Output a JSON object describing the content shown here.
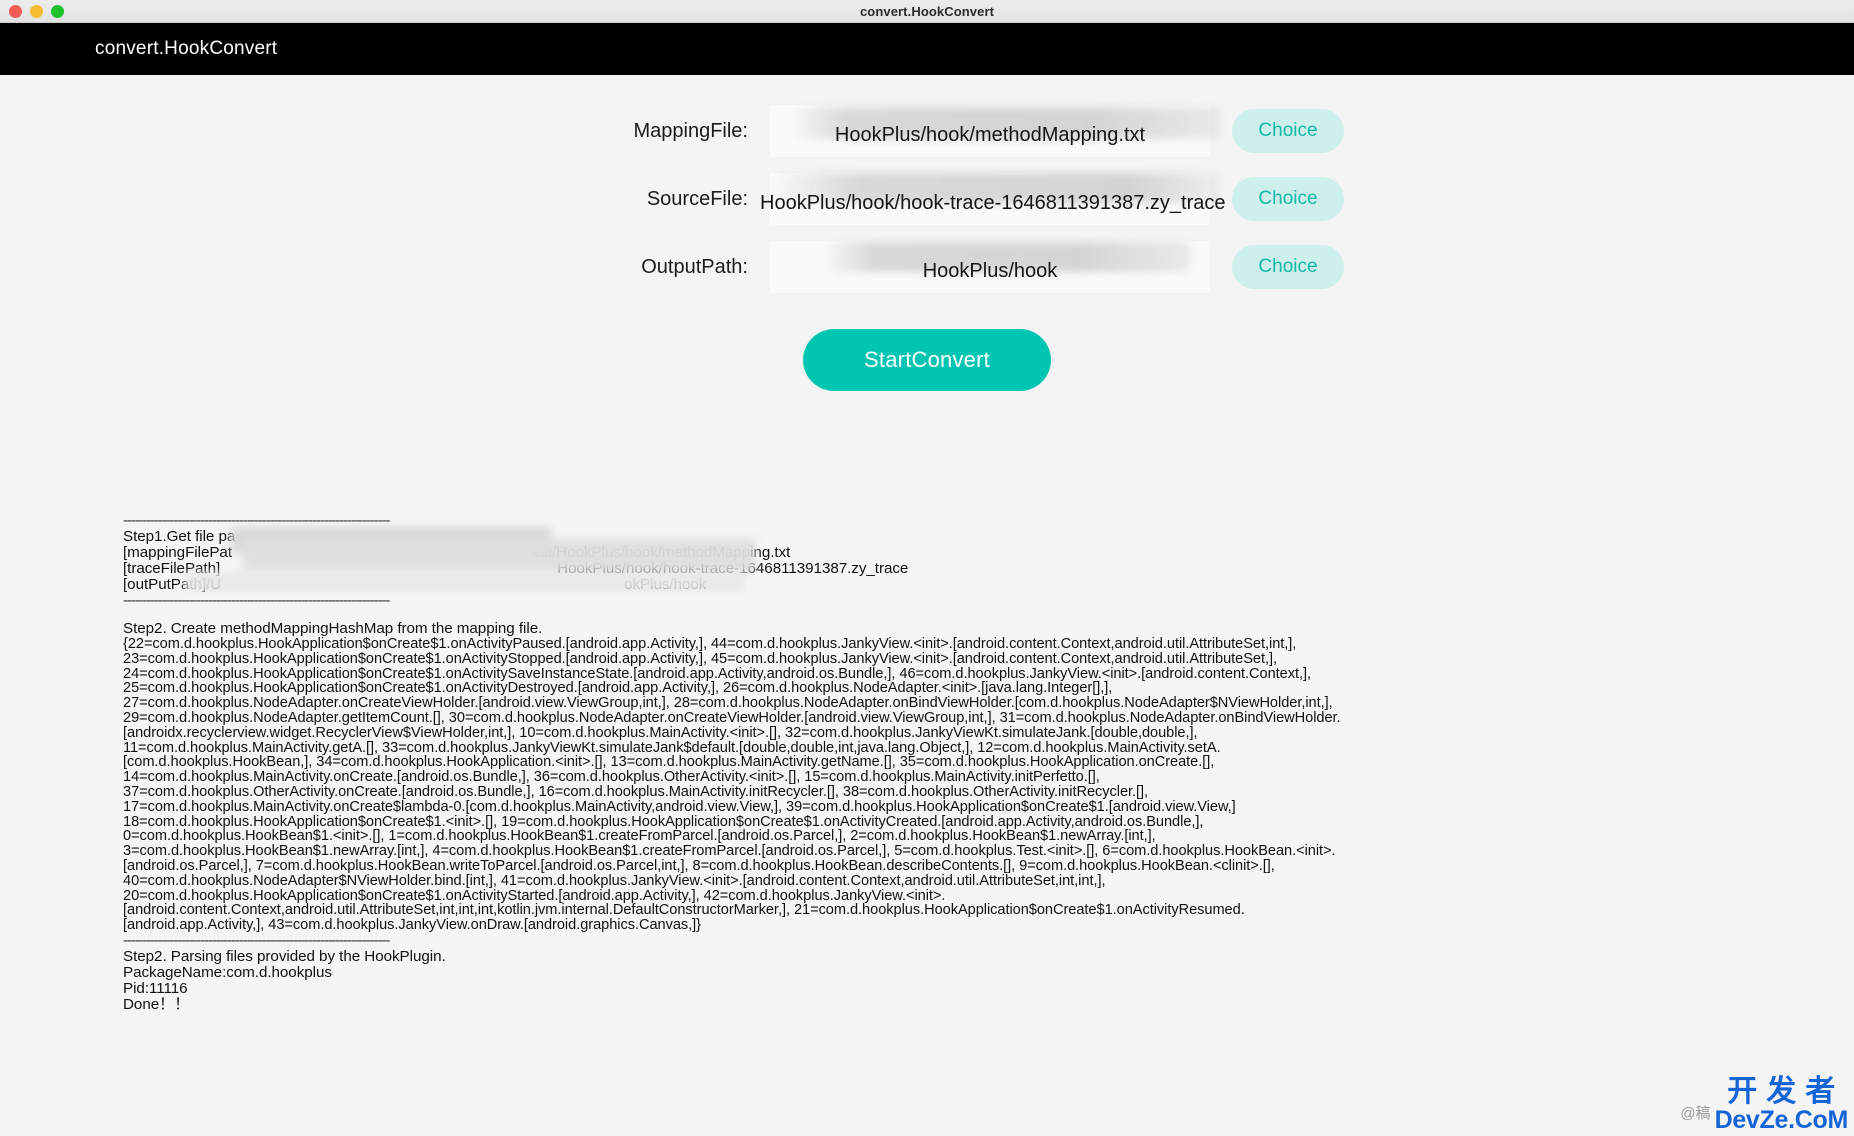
{
  "window": {
    "title": "convert.HookConvert",
    "traffic_lights": [
      {
        "name": "close",
        "color": "#f15d54"
      },
      {
        "name": "minimize",
        "color": "#f5bc2f"
      },
      {
        "name": "maximize",
        "color": "#1dc12c"
      }
    ]
  },
  "header": {
    "title": "convert.HookConvert",
    "background": "#000000",
    "text_color": "#ffffff"
  },
  "colors": {
    "accent": "#00c5b3",
    "choice_bg": "#cdf0ec",
    "choice_text": "#14b8a6",
    "page_bg": "#f4f4f4",
    "log_bg": "#f5f5f5"
  },
  "form": {
    "rows": [
      {
        "label": "MappingFile:",
        "value": "HookPlus/hook/methodMapping.txt",
        "button": "Choice"
      },
      {
        "label": "SourceFile:",
        "value": "HookPlus/hook/hook-trace-1646811391387.zy_trace",
        "button": "Choice"
      },
      {
        "label": "OutputPath:",
        "value": "HookPlus/hook",
        "button": "Choice"
      }
    ],
    "start_button": "StartConvert"
  },
  "log": {
    "head": {
      "rule": "---------------------------------------------------------------------",
      "line_step1": "Step1.Get file pa",
      "line_mapping_key": "[mappingFilePat",
      "line_mapping_tail": "ect/HookPlus/hook/methodMapping.txt",
      "line_trace_key": "[traceFilePath]",
      "line_trace_tail": "HookPlus/hook/hook-trace-1646811391387.zy_trace",
      "line_output_key": "[outPutPath]/U",
      "line_output_tail": "okPlus/hook"
    },
    "step2_title": "Step2. Create methodMappingHashMap from the mapping file.",
    "mapping_lines": [
      "{22=com.d.hookplus.HookApplication$onCreate$1.onActivityPaused.[android.app.Activity,], 44=com.d.hookplus.JankyView.<init>.[android.content.Context,android.util.AttributeSet,int,],",
      "23=com.d.hookplus.HookApplication$onCreate$1.onActivityStopped.[android.app.Activity,], 45=com.d.hookplus.JankyView.<init>.[android.content.Context,android.util.AttributeSet,],",
      "24=com.d.hookplus.HookApplication$onCreate$1.onActivitySaveInstanceState.[android.app.Activity,android.os.Bundle,], 46=com.d.hookplus.JankyView.<init>.[android.content.Context,],",
      "25=com.d.hookplus.HookApplication$onCreate$1.onActivityDestroyed.[android.app.Activity,], 26=com.d.hookplus.NodeAdapter.<init>.[java.lang.Integer[],],",
      "27=com.d.hookplus.NodeAdapter.onCreateViewHolder.[android.view.ViewGroup,int,], 28=com.d.hookplus.NodeAdapter.onBindViewHolder.[com.d.hookplus.NodeAdapter$NViewHolder,int,],",
      "29=com.d.hookplus.NodeAdapter.getItemCount.[], 30=com.d.hookplus.NodeAdapter.onCreateViewHolder.[android.view.ViewGroup,int,], 31=com.d.hookplus.NodeAdapter.onBindViewHolder.",
      "[androidx.recyclerview.widget.RecyclerView$ViewHolder,int,], 10=com.d.hookplus.MainActivity.<init>.[], 32=com.d.hookplus.JankyViewKt.simulateJank.[double,double,],",
      "11=com.d.hookplus.MainActivity.getA.[], 33=com.d.hookplus.JankyViewKt.simulateJank$default.[double,double,int,java.lang.Object,], 12=com.d.hookplus.MainActivity.setA.",
      "[com.d.hookplus.HookBean,], 34=com.d.hookplus.HookApplication.<init>.[], 13=com.d.hookplus.MainActivity.getName.[], 35=com.d.hookplus.HookApplication.onCreate.[],",
      "14=com.d.hookplus.MainActivity.onCreate.[android.os.Bundle,], 36=com.d.hookplus.OtherActivity.<init>.[], 15=com.d.hookplus.MainActivity.initPerfetto.[],",
      "37=com.d.hookplus.OtherActivity.onCreate.[android.os.Bundle,], 16=com.d.hookplus.MainActivity.initRecycler.[], 38=com.d.hookplus.OtherActivity.initRecycler.[],",
      "17=com.d.hookplus.MainActivity.onCreate$lambda-0.[com.d.hookplus.MainActivity,android.view.View,], 39=com.d.hookplus.HookApplication$onCreate$1.[android.view.View,]",
      "18=com.d.hookplus.HookApplication$onCreate$1.<init>.[], 19=com.d.hookplus.HookApplication$onCreate$1.onActivityCreated.[android.app.Activity,android.os.Bundle,],",
      "0=com.d.hookplus.HookBean$1.<init>.[], 1=com.d.hookplus.HookBean$1.createFromParcel.[android.os.Parcel,], 2=com.d.hookplus.HookBean$1.newArray.[int,],",
      "3=com.d.hookplus.HookBean$1.newArray.[int,], 4=com.d.hookplus.HookBean$1.createFromParcel.[android.os.Parcel,], 5=com.d.hookplus.Test.<init>.[], 6=com.d.hookplus.HookBean.<init>.",
      "[android.os.Parcel,], 7=com.d.hookplus.HookBean.writeToParcel.[android.os.Parcel,int,], 8=com.d.hookplus.HookBean.describeContents.[], 9=com.d.hookplus.HookBean.<clinit>.[],",
      "40=com.d.hookplus.NodeAdapter$NViewHolder.bind.[int,], 41=com.d.hookplus.JankyView.<init>.[android.content.Context,android.util.AttributeSet,int,int,],",
      "20=com.d.hookplus.HookApplication$onCreate$1.onActivityStarted.[android.app.Activity,], 42=com.d.hookplus.JankyView.<init>.",
      "[android.content.Context,android.util.AttributeSet,int,int,int,kotlin.jvm.internal.DefaultConstructorMarker,], 21=com.d.hookplus.HookApplication$onCreate$1.onActivityResumed.",
      "[android.app.Activity,], 43=com.d.hookplus.JankyView.onDraw.[android.graphics.Canvas,]}"
    ],
    "rule_bottom": "---------------------------------------------------------------------",
    "tail_lines": [
      "Step2. Parsing files provided by the HookPlugin.",
      "PackageName:com.d.hookplus",
      "Pid:11116",
      "Done！！"
    ]
  },
  "watermark": {
    "at": "@稿",
    "cn": "开发者",
    "en": "DevZe.CoM",
    "color": "#1565d8"
  }
}
